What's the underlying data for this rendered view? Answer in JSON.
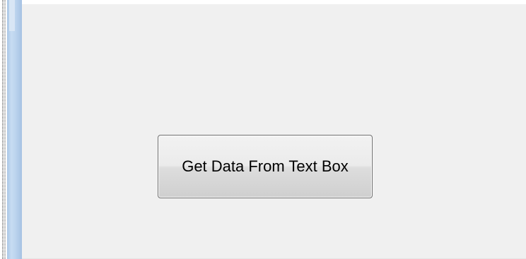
{
  "form": {
    "button_label": "Get Data From Text Box"
  }
}
